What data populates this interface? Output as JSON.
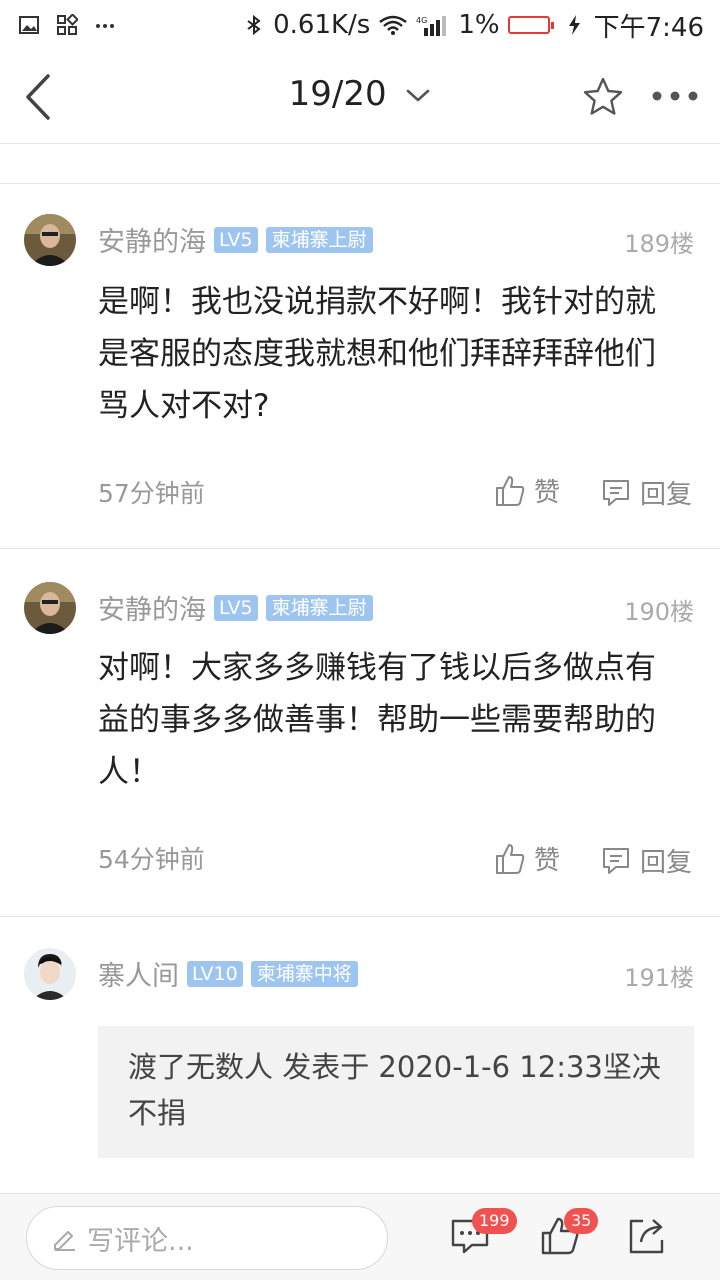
{
  "status_bar": {
    "speed": "0.61K/s",
    "network": "4G",
    "battery": "1%",
    "time": "下午7:46"
  },
  "header": {
    "page_indicator": "19/20"
  },
  "comments": [
    {
      "username": "安静的海",
      "level": "LV5",
      "rank": "柬埔寨上尉",
      "floor": "189楼",
      "content": "是啊！我也没说捐款不好啊！我针对的就是客服的态度我就想和他们拜辞拜辞他们骂人对不对?",
      "time": "57分钟前",
      "like_label": "赞",
      "reply_label": "回复"
    },
    {
      "username": "安静的海",
      "level": "LV5",
      "rank": "柬埔寨上尉",
      "floor": "190楼",
      "content": "对啊！大家多多赚钱有了钱以后多做点有益的事多多做善事！帮助一些需要帮助的人！",
      "time": "54分钟前",
      "like_label": "赞",
      "reply_label": "回复"
    },
    {
      "username": "寨人间",
      "level": "LV10",
      "rank": "柬埔寨中将",
      "floor": "191楼",
      "quote": "渡了无数人 发表于 2020-1-6 12:33坚决不捐"
    }
  ],
  "bottom_bar": {
    "input_placeholder": "写评论...",
    "comment_count": "199",
    "like_count": "35"
  },
  "colors": {
    "badge_red": "#f05252",
    "tag_blue": "#9ec5f0",
    "battery_red": "#e53935"
  }
}
